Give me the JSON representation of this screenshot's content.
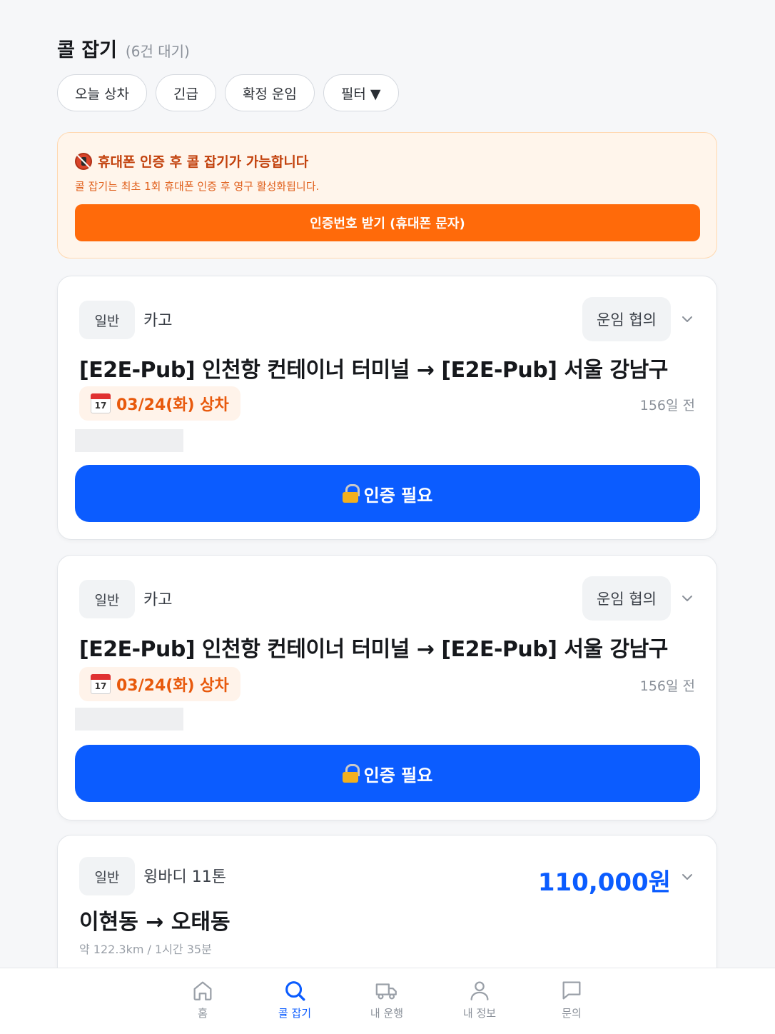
{
  "header": {
    "title": "콜 잡기",
    "count": "(6건 대기)"
  },
  "chips": [
    "오늘 상차",
    "긴급",
    "확정 운임",
    "필터 ▼"
  ],
  "alert": {
    "title": "휴대폰 인증 후 콜 잡기가 가능합니다",
    "subtitle": "콜 잡기는 최초 1회 휴대폰 인증 후 영구 활성화됩니다.",
    "button": "인증번호 받기 (휴대폰 문자)"
  },
  "cards": [
    {
      "tag": "일반",
      "vehicle": "카고",
      "fare": "운임 협의",
      "route": "[E2E-Pub] 인천항 컨테이너 터미널 → [E2E-Pub] 서울 강남구",
      "date_icon_day": "17",
      "date": "03/24(화) 상차",
      "ago": "156일 전",
      "auth_button": "인증 필요"
    },
    {
      "tag": "일반",
      "vehicle": "카고",
      "fare": "운임 협의",
      "route": "[E2E-Pub] 인천항 컨테이너 터미널 → [E2E-Pub] 서울 강남구",
      "date_icon_day": "17",
      "date": "03/24(화) 상차",
      "ago": "156일 전",
      "auth_button": "인증 필요"
    },
    {
      "tag": "일반",
      "vehicle": "윙바디 11톤",
      "price": "110,000원",
      "route": "이현동 → 오태동",
      "distance": "약 122.3km / 1시간 35분"
    }
  ],
  "nav": [
    {
      "label": "홈",
      "icon": "home-icon",
      "active": false
    },
    {
      "label": "콜 잡기",
      "icon": "search-icon",
      "active": true
    },
    {
      "label": "내 운행",
      "icon": "truck-icon",
      "active": false
    },
    {
      "label": "내 정보",
      "icon": "user-icon",
      "active": false
    },
    {
      "label": "문의",
      "icon": "chat-icon",
      "active": false
    }
  ],
  "colors": {
    "primary": "#0b5cff",
    "alert_accent": "#ff6a0a",
    "date_accent": "#e8590c"
  }
}
